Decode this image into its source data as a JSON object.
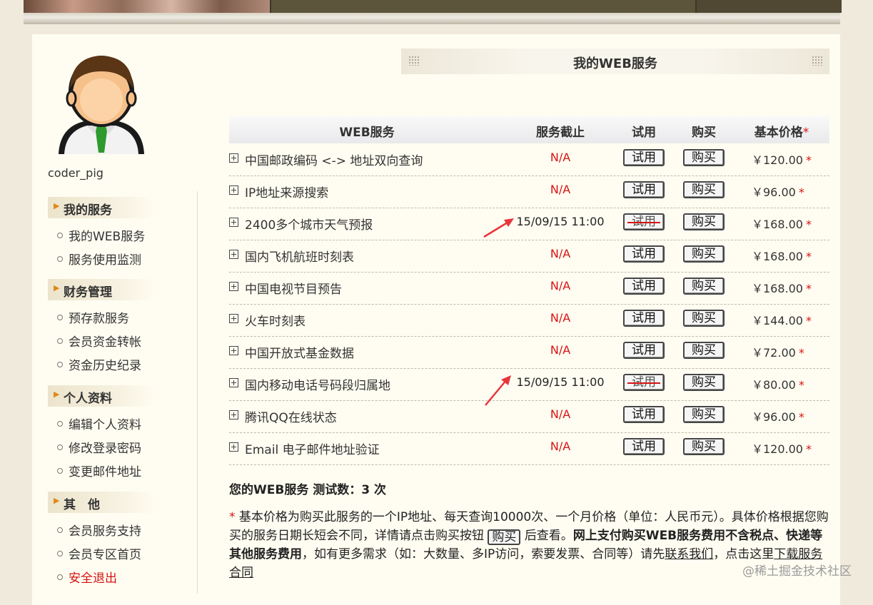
{
  "user": {
    "name": "coder_pig"
  },
  "sidebar": {
    "sections": [
      {
        "title": "我的服务",
        "items": [
          "我的WEB服务",
          "服务使用监测"
        ]
      },
      {
        "title": "财务管理",
        "items": [
          "预存款服务",
          "会员资金转帐",
          "资金历史纪录"
        ]
      },
      {
        "title": "个人资料",
        "items": [
          "编辑个人资料",
          "修改登录密码",
          "变更邮件地址"
        ]
      },
      {
        "title": "其　他",
        "items": [
          "会员服务支持",
          "会员专区首页",
          "安全退出"
        ]
      }
    ]
  },
  "header": {
    "title": "我的WEB服务"
  },
  "table": {
    "columns": {
      "service": "WEB服务",
      "deadline": "服务截止",
      "trial": "试用",
      "buy": "购买",
      "price": "基本价格",
      "price_mark": "*"
    },
    "rows": [
      {
        "name": "中国邮政编码 <-> 地址双向查询",
        "deadline": "N/A",
        "trial": "试用",
        "buy": "购买",
        "price": "￥120.00",
        "mark": "*"
      },
      {
        "name": "IP地址来源搜索",
        "deadline": "N/A",
        "trial": "试用",
        "buy": "购买",
        "price": "￥96.00",
        "mark": "*"
      },
      {
        "name": "2400多个城市天气预报",
        "deadline": "15/09/15 11:00",
        "trial": "试用",
        "buy": "购买",
        "price": "￥168.00",
        "mark": "*"
      },
      {
        "name": "国内飞机航班时刻表",
        "deadline": "N/A",
        "trial": "试用",
        "buy": "购买",
        "price": "￥168.00",
        "mark": "*"
      },
      {
        "name": "中国电视节目预告",
        "deadline": "N/A",
        "trial": "试用",
        "buy": "购买",
        "price": "￥168.00",
        "mark": "*"
      },
      {
        "name": "火车时刻表",
        "deadline": "N/A",
        "trial": "试用",
        "buy": "购买",
        "price": "￥144.00",
        "mark": "*"
      },
      {
        "name": "中国开放式基金数据",
        "deadline": "N/A",
        "trial": "试用",
        "buy": "购买",
        "price": "￥72.00",
        "mark": "*"
      },
      {
        "name": "国内移动电话号码段归属地",
        "deadline": "15/09/15 11:00",
        "trial": "试用",
        "buy": "购买",
        "price": "￥80.00",
        "mark": "*"
      },
      {
        "name": "腾讯QQ在线状态",
        "deadline": "N/A",
        "trial": "试用",
        "buy": "购买",
        "price": "￥96.00",
        "mark": "*"
      },
      {
        "name": "Email 电子邮件地址验证",
        "deadline": "N/A",
        "trial": "试用",
        "buy": "购买",
        "price": "￥120.00",
        "mark": "*"
      }
    ]
  },
  "trials_text": "您的WEB服务 测试数：3 次",
  "note": {
    "mark": "*",
    "part1": "基本价格为购买此服务的一个IP地址、每天查询10000次、一个月价格（单位：人民币元）。具体价格根据您购买的服务日期长短会不同，详情请点击购买按钮",
    "button": "购买",
    "part2": "后查看。",
    "bold": "网上支付购买WEB服务费用不含税点、快递等其他服务费用",
    "part3": "，如有更多需求（如：大数量、多IP访问，索要发票、合同等）请先",
    "link1": "联系我们",
    "part4": "，点击这里",
    "link2": "下载服务合同"
  },
  "watermark": "@稀土掘金技术社区",
  "colors": {
    "accent_red": "#d51313",
    "panel_bg": "#fffdf1",
    "page_bg": "#efeadc"
  }
}
